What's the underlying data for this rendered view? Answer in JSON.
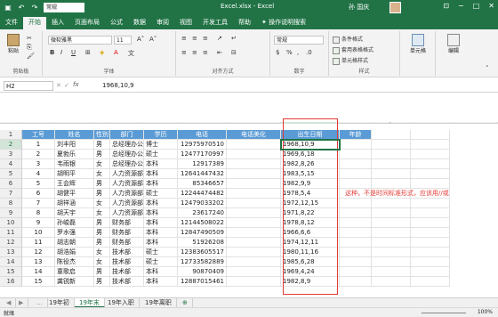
{
  "title_bar": {
    "file_title": "Excel.xlsx - Excel",
    "user": "孙 国庆",
    "font_box": "常规"
  },
  "menu": [
    "文件",
    "开始",
    "插入",
    "页面布局",
    "公式",
    "数据",
    "审阅",
    "视图",
    "开发工具",
    "帮助",
    "操作说明搜索"
  ],
  "ribbon": {
    "paste": "粘贴",
    "font_name": "微软雅黑",
    "font_size": "11",
    "number_format": "常规",
    "cond_format": "条件格式",
    "table_format": "套用表格格式",
    "cell_style": "单元格样式",
    "cells": "单元格",
    "editing": "编辑",
    "groups": [
      "剪贴板",
      "字体",
      "对齐方式",
      "数字",
      "样式"
    ]
  },
  "formula_bar": {
    "name_box": "H2",
    "fx": "fx",
    "value": "1968,10,9"
  },
  "columns": [
    "A",
    "B",
    "C",
    "D",
    "E",
    "F",
    "G",
    "H",
    "I",
    "J",
    "K",
    "L"
  ],
  "row_numbers": [
    "1",
    "2",
    "3",
    "4",
    "5",
    "6",
    "7",
    "8",
    "9",
    "10",
    "11",
    "12",
    "13",
    "14",
    "15",
    "16"
  ],
  "headers": [
    "工号",
    "姓名",
    "性别",
    "部门",
    "学历",
    "电话",
    "电话美化",
    "出生日期",
    "年龄"
  ],
  "rows": [
    [
      "1",
      "刘丰阳",
      "男",
      "总经理办公室",
      "博士",
      "12975970510",
      "",
      "1968,10,9"
    ],
    [
      "2",
      "夏勃乐",
      "男",
      "总经理办公室",
      "硕士",
      "12477170997",
      "",
      "1969,6,18"
    ],
    [
      "3",
      "韦雨银",
      "女",
      "总经理办公室",
      "本科",
      "12917389",
      "",
      "1982,8,26"
    ],
    [
      "4",
      "胡明平",
      "女",
      "人力资源部",
      "本科",
      "12641447432",
      "",
      "1983,5,15"
    ],
    [
      "5",
      "王会辉",
      "男",
      "人力资源部",
      "本科",
      "85346657",
      "",
      "1982,9,9"
    ],
    [
      "6",
      "胡健平",
      "男",
      "人力资源部",
      "硕士",
      "12244474482",
      "",
      "1978,5,4"
    ],
    [
      "7",
      "胡祥涵",
      "女",
      "人力资源部",
      "本科",
      "12479033202",
      "",
      "1972,12,15"
    ],
    [
      "8",
      "胡天宇",
      "女",
      "人力资源部",
      "本科",
      "23617240",
      "",
      "1971,8,22"
    ],
    [
      "9",
      "孙峻磊",
      "男",
      "财务部",
      "本科",
      "12144508022",
      "",
      "1978,8,12"
    ],
    [
      "10",
      "罗水强",
      "男",
      "财务部",
      "本科",
      "12847490509",
      "",
      "1966,6,6"
    ],
    [
      "11",
      "胡志朝",
      "男",
      "财务部",
      "本科",
      "51926208",
      "",
      "1974,12,11"
    ],
    [
      "12",
      "胡浩娟",
      "女",
      "技术部",
      "硕士",
      "12383605517",
      "",
      "1980,11,16"
    ],
    [
      "13",
      "陈役杰",
      "女",
      "技术部",
      "硕士",
      "12733582889",
      "",
      "1985,6,28"
    ],
    [
      "14",
      "童歌启",
      "男",
      "技术部",
      "本科",
      "90870409",
      "",
      "1969,4,24"
    ],
    [
      "15",
      "龚锐新",
      "男",
      "技术部",
      "本科",
      "12887015461",
      "",
      "1982,8,9"
    ]
  ],
  "note": "这种，不是时间标准形式，应该用//或",
  "sheet_tabs": [
    "19年初",
    "19年末",
    "19年入职",
    "19年离职"
  ],
  "status": {
    "ready": "就绪",
    "zoom": "100%"
  },
  "colors": {
    "accent": "#217346",
    "header_fill": "#5b9bd5",
    "note_red": "#e53935"
  }
}
